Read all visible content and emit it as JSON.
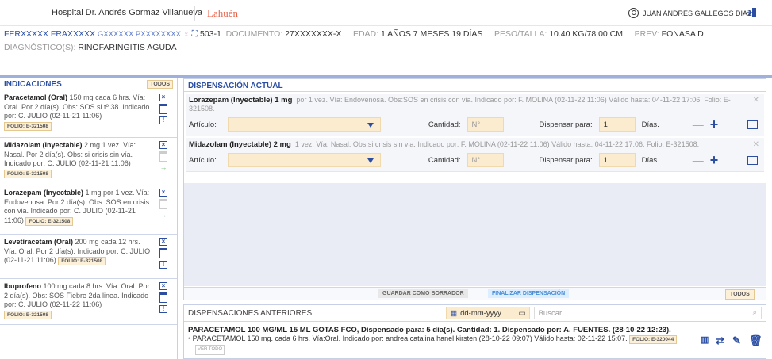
{
  "topbar": {
    "hospital": "Hospital Dr. Andrés Gormaz Villanueva",
    "brand": "Lahuén",
    "user": "JUAN ANDRÉS GALLEGOS DIAZ"
  },
  "patient": {
    "name": "FERXXXXX FRAXXXXX",
    "name2": "GXXXXXX PXXXXXXXX",
    "bed": "503-1",
    "doc_label": "DOCUMENTO:",
    "doc": "27XXXXXXX-X",
    "age_label": "EDAD:",
    "age": "1 AÑOS 7 MESES 19 DÍAS",
    "wt_label": "PESO/TALLA:",
    "wt": "10.40 KG/78.00 CM",
    "prev_label": "PREV:",
    "prev": "FONASA D",
    "diag_label": "DIAGNÓSTICO(S):",
    "diag": "RINOFARINGITIS AGUDA"
  },
  "indications": {
    "title": "INDICACIONES",
    "todos": "TODOS",
    "items": [
      {
        "drug": "Paracetamol (Oral)",
        "text": " 150 mg cada 6 hrs. Vía: Oral. Por 2 día(s). Obs: SOS si tº 38. Indicado por: C. JULIO (02-11-21 11:06)",
        "folio": "FOLIO: E-321508"
      },
      {
        "drug": "Midazolam (Inyectable)",
        "text": " 2 mg 1 vez. Vía: Nasal. Por 2 día(s). Obs: si crisis sin vía. Indicado por: C. JULIO (02-11-21 11:06)",
        "folio": "FOLIO: E-321508"
      },
      {
        "drug": "Lorazepam (Inyectable)",
        "text": " 1 mg por 1 vez. Vía: Endovenosa. Por 2 día(s). Obs: SOS en crisis con via. Indicado por: C. JULIO (02-11-21 11:06)",
        "folio": "FOLIO: E-321508"
      },
      {
        "drug": "Levetiracetam (Oral)",
        "text": " 200 mg cada 12 hrs. Vía: Oral. Por 2 día(s). Indicado por: C. JULIO (02-11-21 11:06)",
        "folio": "FOLIO: E-321508"
      },
      {
        "drug": "Ibuprofeno",
        "text": " 100 mg cada 8 hrs. Vía: Oral. Por 2 día(s). Obs: SOS Fiebre 2da linea. Indicado por: C. JULIO (02-11-22 11:06)",
        "folio": "FOLIO: E-321508"
      }
    ]
  },
  "current": {
    "title": "DISPENSACIÓN ACTUAL",
    "articulo": "Artículo:",
    "cantidad": "Cantidad:",
    "cant_ph": "N°",
    "dispensar": "Dispensar para:",
    "dias_val": "1",
    "dias": "Días.",
    "items": [
      {
        "drug": "Lorazepam (Inyectable) 1 mg",
        "text": "por 1 vez. Vía: Endovenosa. Obs:SOS en crisis con via. Indicado por: F. MOLINA (02-11-22 11:06) Válido hasta: 04-11-22 17:06. Folio: E-321508."
      },
      {
        "drug": "Midazolam (Inyectable) 2 mg",
        "text": "1 vez. Vía: Nasal. Obs:si crisis sin via. Indicado por: F. MOLINA (02-11-22 11:06) Válido hasta: 04-11-22 17:06. Folio: E-321508."
      }
    ],
    "save_draft": "GUARDAR COMO BORRADOR",
    "finish": "FINALIZAR DISPENSACIÓN",
    "todos": "TODOS"
  },
  "previous": {
    "title": "DISPENSACIONES ANTERIORES",
    "date_ph": "dd-mm-yyyy",
    "search_ph": "Buscar...",
    "entry_head": "PARACETAMOL 100 MG/ML 15 ML GOTAS FCO, Dispensado para: 5 día(s).  Cantidad: 1.  Dispensado por: A. FUENTES. (28-10-22 12:23).",
    "entry_text": "PARACETAMOL 150 mg. cada 6 hrs. Vía:Oral. Indicado por: andrea catalina hanel kirsten (28-10-22 09:07) Válido hasta: 02-11-22 15:07.",
    "entry_folio": "FOLIO: E-320044",
    "ver_todo": "VER TODO"
  }
}
